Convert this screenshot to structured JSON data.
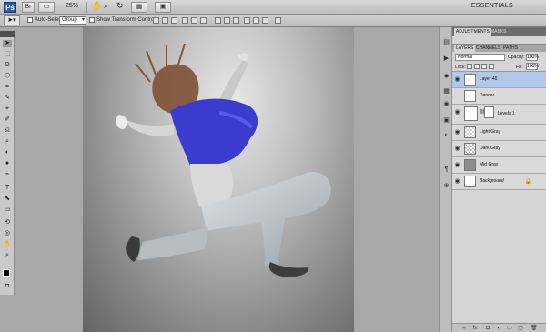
{
  "appbar": {
    "logo": "Ps",
    "zoom": "25%",
    "workspace": "ESSENTIALS",
    "buttons": [
      "Br",
      "▭",
      "▦"
    ]
  },
  "options": {
    "tool_glyph": "➤▾",
    "auto_select_label": "Auto-Select:",
    "auto_select_value": "Group",
    "show_transform_label": "Show Transform Controls"
  },
  "tools": [
    "➤",
    "⬚",
    "ʘ",
    "⬡",
    "⌗",
    "✎",
    "⌖",
    "✐",
    "⎌",
    "⌕",
    "◐",
    "●",
    "⌁",
    "T",
    "⬉",
    "▭",
    "✋",
    "⌕"
  ],
  "panels": {
    "top_tabs": [
      "ADJUSTMENTS",
      "MASKS"
    ],
    "layer_tabs": [
      "LAYERS",
      "CHANNELS",
      "PATHS"
    ],
    "blend_mode": "Normal",
    "opacity_label": "Opacity:",
    "opacity_value": "100%",
    "lock_label": "Lock:",
    "fill_label": "Fill:",
    "fill_value": "100%"
  },
  "layers": [
    {
      "name": "Layer 46",
      "thumb": "dancer",
      "selected": true
    },
    {
      "name": "Dancer",
      "thumb": "dancer",
      "selected": false
    },
    {
      "name": "Levels 1",
      "thumb": "levels",
      "selected": false
    },
    {
      "name": "Light Gray",
      "thumb": "checker",
      "selected": false
    },
    {
      "name": "Dark Gray",
      "thumb": "dark",
      "selected": false
    },
    {
      "name": "Mid Gray",
      "thumb": "gray",
      "selected": false
    },
    {
      "name": "Background",
      "thumb": "white",
      "selected": false
    }
  ],
  "footer_icons": [
    "∞",
    "fx",
    "◘",
    "◐",
    "▭",
    "▢",
    "🗑"
  ]
}
